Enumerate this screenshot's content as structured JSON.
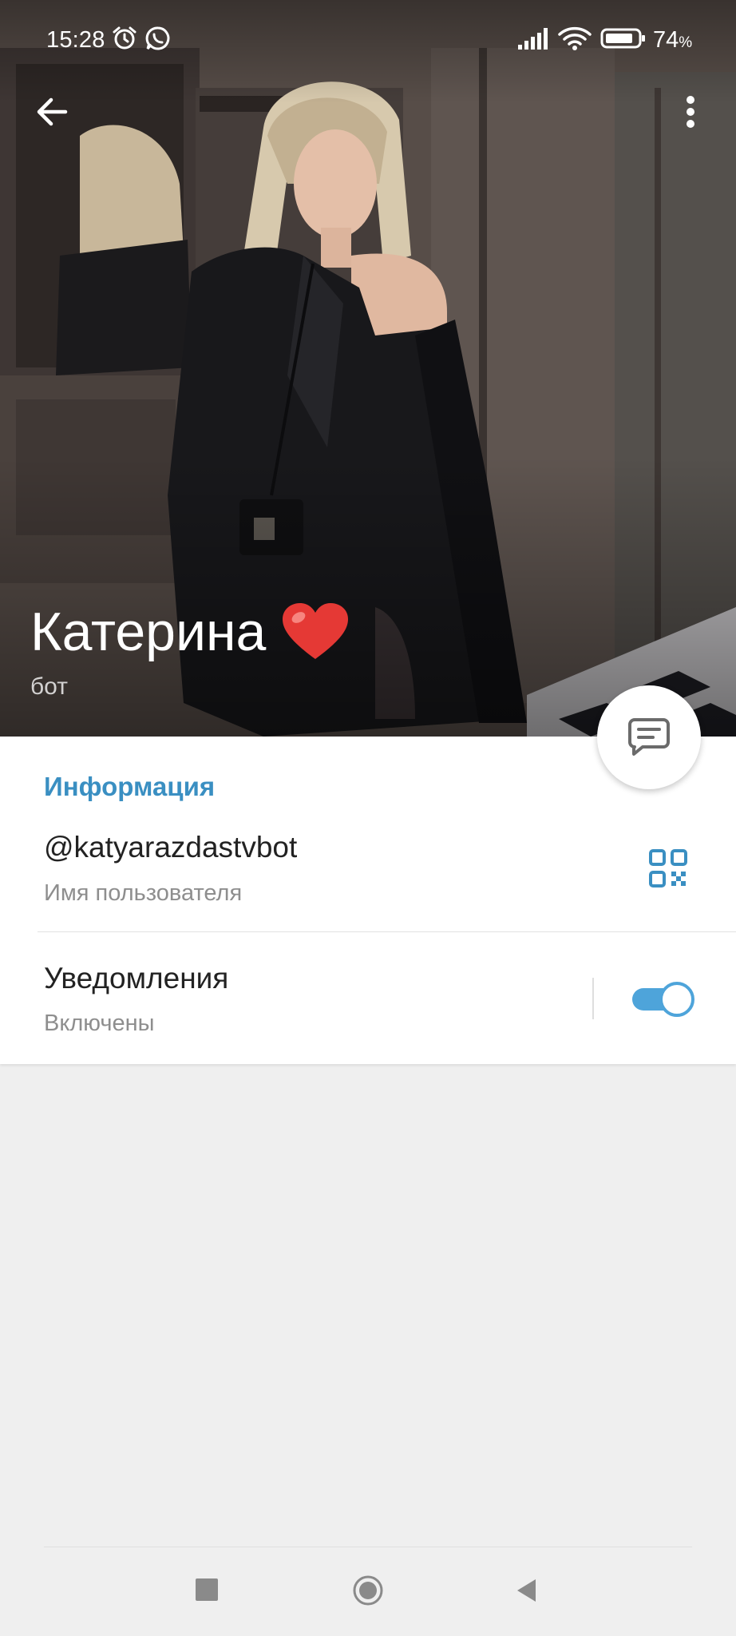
{
  "status_bar": {
    "time": "15:28",
    "battery_percent": "74",
    "battery_unit": "%",
    "icons": [
      "alarm-icon",
      "whatsapp-icon",
      "signal-icon",
      "wifi-icon",
      "battery-icon"
    ]
  },
  "toolbar": {
    "back_icon": "arrow-left-icon",
    "menu_icon": "more-vertical-icon"
  },
  "profile": {
    "name": "Катерина",
    "emoji": "❤️",
    "subtitle": "бот"
  },
  "info": {
    "section_title": "Информация",
    "username": "@katyarazdastvbot",
    "username_label": "Имя пользователя",
    "notifications_label": "Уведомления",
    "notifications_status": "Включены",
    "notifications_on": true
  },
  "colors": {
    "accent": "#3a8fc2",
    "toggle": "#4ea4da",
    "background": "#efefef"
  }
}
